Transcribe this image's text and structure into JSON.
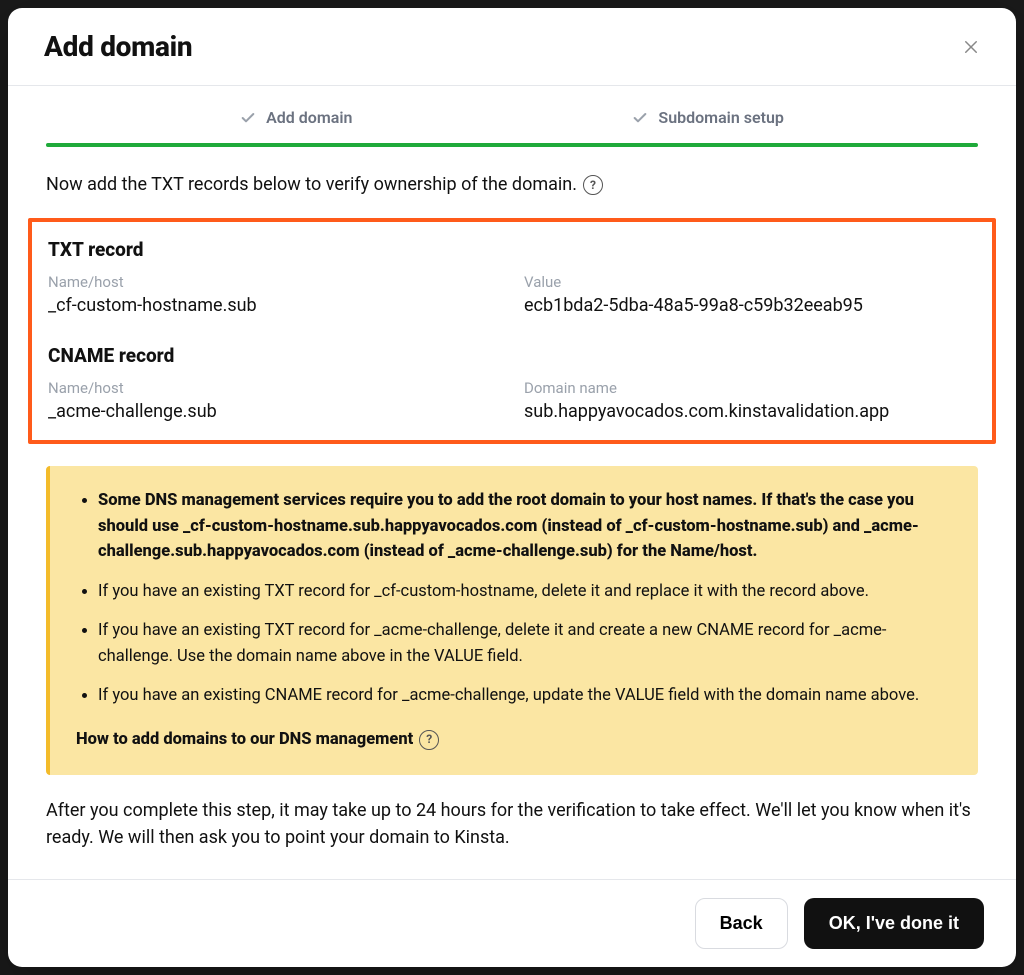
{
  "modal": {
    "title": "Add domain",
    "steps": [
      {
        "label": "Add domain",
        "done": true
      },
      {
        "label": "Subdomain setup",
        "done": true
      }
    ],
    "instruction": "Now add the TXT records below to verify ownership of the domain.",
    "txt_record": {
      "heading": "TXT record",
      "name_label": "Name/host",
      "name_value": "_cf-custom-hostname.sub",
      "value_label": "Value",
      "value_value": "ecb1bda2-5dba-48a5-99a8-c59b32eeab95"
    },
    "cname_record": {
      "heading": "CNAME record",
      "name_label": "Name/host",
      "name_value": "_acme-challenge.sub",
      "value_label": "Domain name",
      "value_value": "sub.happyavocados.com.kinstavalidation.app"
    },
    "callout": {
      "b1_pre": "Some DNS management services require you to add the root domain to your host names. If that's the case you should use ",
      "b1_host1": "_cf-custom-hostname.sub.happyavocados.com",
      "b1_mid": " (instead of _cf-custom-hostname.sub) and ",
      "b1_host2": "_acme-challenge.sub.happyavocados.com",
      "b1_post": " (instead of _acme-challenge.sub) for the Name/host.",
      "b2": "If you have an existing TXT record for _cf-custom-hostname, delete it and replace it with the record above.",
      "b3": "If you have an existing TXT record for _acme-challenge, delete it and create a new CNAME record for _acme-challenge. Use the domain name above in the VALUE field.",
      "b4": "If you have an existing CNAME record for _acme-challenge, update the VALUE field with the domain name above.",
      "link": "How to add domains to our DNS management"
    },
    "after_text": "After you complete this step, it may take up to 24 hours for the verification to take effect. We'll let you know when it's ready. We will then ask you to point your domain to Kinsta.",
    "buttons": {
      "back": "Back",
      "ok": "OK, I've done it"
    }
  }
}
